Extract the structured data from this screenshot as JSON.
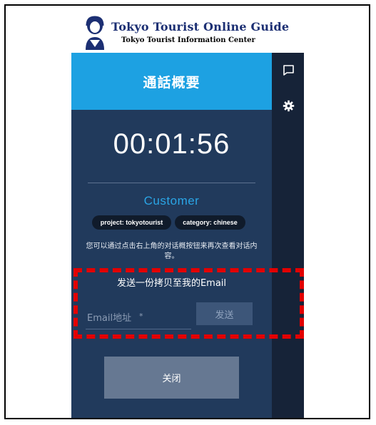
{
  "logo": {
    "title": "Tokyo Tourist Online Guide",
    "subtitle": "Tokyo Tourist Information Center"
  },
  "header": {
    "title": "通話概要"
  },
  "timer": "00:01:56",
  "customer_label": "Customer",
  "tags": {
    "project": "project: tokyotourist",
    "category": "category: chinese"
  },
  "hint": "您可以通过点击右上角的对话概按钮来再次查看对话内容。",
  "email": {
    "title": "发送一份拷贝至我的Email",
    "placeholder": "Email地址",
    "required_mark": "*",
    "send_label": "发送"
  },
  "close_label": "关闭",
  "sidebar": {
    "icons": [
      "chat-icon",
      "gear-icon"
    ]
  },
  "colors": {
    "header_blue": "#1da1e2",
    "panel_navy": "#213a5c",
    "sidebar_dark": "#162338",
    "accent_cyan": "#2aa5e6",
    "highlight_red": "#e30000"
  }
}
